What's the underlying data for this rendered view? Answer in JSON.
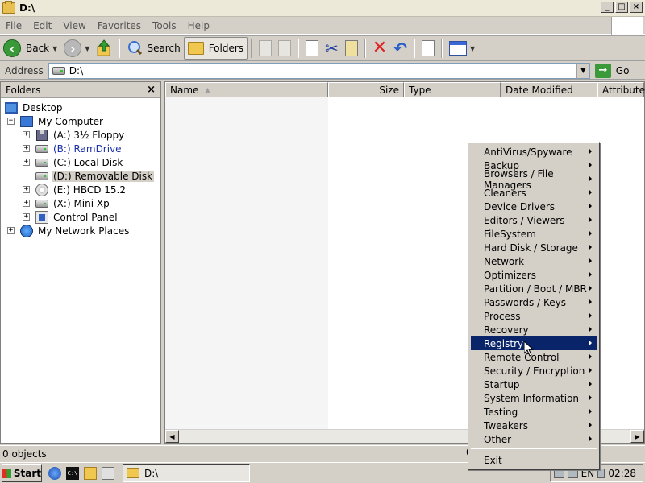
{
  "window": {
    "title": "D:\\"
  },
  "caption_buttons": {
    "minimize": "_",
    "maximize": "□",
    "close": "×"
  },
  "menubar": [
    "File",
    "Edit",
    "View",
    "Favorites",
    "Tools",
    "Help"
  ],
  "toolbar": {
    "back": "Back",
    "search": "Search",
    "folders": "Folders"
  },
  "address": {
    "label": "Address",
    "value": "D:\\",
    "go": "Go"
  },
  "folders_pane": {
    "title": "Folders",
    "close": "×",
    "tree": [
      {
        "label": "Desktop"
      },
      {
        "label": "My Computer"
      },
      {
        "label": "(A:) 3½ Floppy"
      },
      {
        "label": "(B:) RamDrive"
      },
      {
        "label": "(C:) Local Disk"
      },
      {
        "label": "(D:) Removable Disk"
      },
      {
        "label": "(E:) HBCD 15.2"
      },
      {
        "label": "(X:) Mini Xp"
      },
      {
        "label": "Control Panel"
      },
      {
        "label": "My Network Places"
      }
    ]
  },
  "file_list": {
    "columns": [
      "Name",
      "Size",
      "Type",
      "Date Modified",
      "Attributes"
    ]
  },
  "status": {
    "text": "0 objects",
    "cell": "0"
  },
  "context_menu": {
    "items": [
      "AntiVirus/Spyware",
      "Backup",
      "Browsers / File Managers",
      "Cleaners",
      "Device Drivers",
      "Editors / Viewers",
      "FileSystem",
      "Hard Disk / Storage",
      "Network",
      "Optimizers",
      "Partition / Boot / MBR",
      "Passwords / Keys",
      "Process",
      "Recovery",
      "Registry",
      "Remote Control",
      "Security / Encryption",
      "Startup",
      "System Information",
      "Testing",
      "Tweakers",
      "Other"
    ],
    "highlighted": "Registry",
    "exit": "Exit"
  },
  "taskbar": {
    "start": "Start",
    "task": "D:\\",
    "lang": "EN",
    "clock": "02:28"
  },
  "colors": {
    "selection": "#0a246a",
    "face": "#d4d0c8"
  }
}
